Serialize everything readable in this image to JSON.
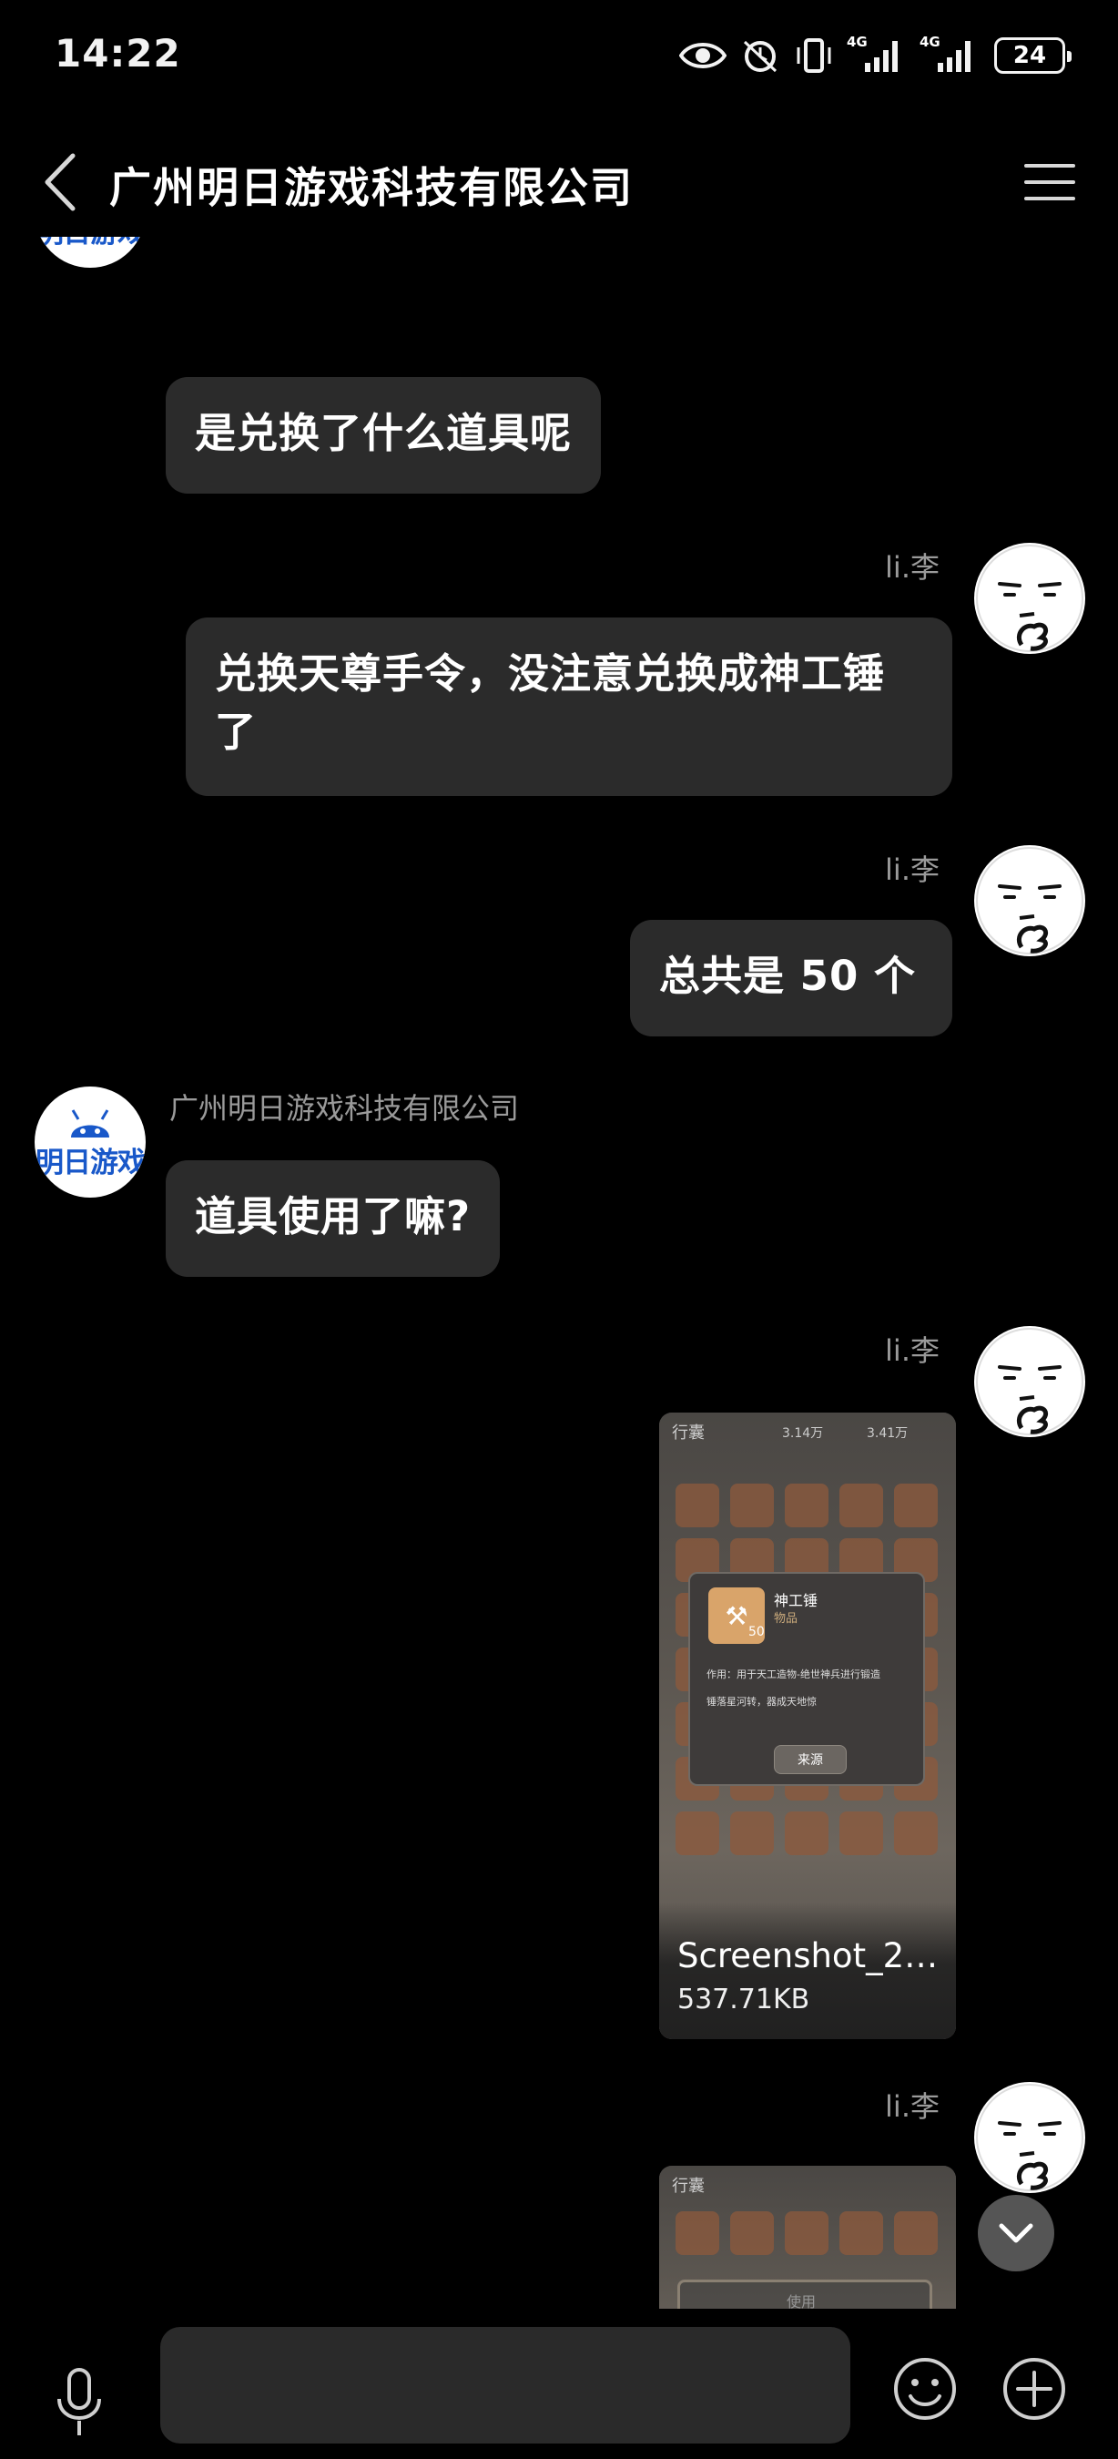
{
  "status_bar": {
    "time": "14:22",
    "battery": "24",
    "network_1": "4G",
    "network_2": "4G",
    "icons": [
      "eye-icon",
      "alarm-icon",
      "vibrate-icon",
      "signal-icon",
      "signal-icon",
      "battery-icon"
    ]
  },
  "header": {
    "title": "广州明日游戏科技有限公司",
    "back_icon": "chevron-left-icon",
    "menu_icon": "menu-icon"
  },
  "company": {
    "logo_text": "明日游戏",
    "name": "广州明日游戏科技有限公司"
  },
  "messages": [
    {
      "sender": "company",
      "text": "是兑换了什么道具呢"
    },
    {
      "sender": "user",
      "name": "li.李",
      "text": "兑换天尊手令，没注意兑换成神工锤了"
    },
    {
      "sender": "user",
      "name": "li.李",
      "text": "总共是 50 个"
    },
    {
      "sender": "company",
      "name": "广州明日游戏科技有限公司",
      "text": "道具使用了嘛?"
    },
    {
      "sender": "user",
      "name": "li.李",
      "type": "image",
      "file_name": "Screenshot_2…",
      "file_size": "537.71KB",
      "preview": {
        "top_label": "行囊",
        "stat_1": "3.14万",
        "stat_2": "3.41万",
        "item_name": "神工锤",
        "item_type": "物品",
        "item_count": "50",
        "description": "作用：用于天工造物-绝世神兵进行锻造",
        "description_2": "锤落星河转，器成天地惊",
        "source_button": "来源"
      }
    },
    {
      "sender": "user",
      "name": "li.李",
      "type": "image",
      "preview": {
        "top_label": "行囊",
        "popup_label": "使用"
      }
    }
  ],
  "input": {
    "placeholder": ""
  },
  "colors": {
    "background": "#000000",
    "bubble": "#2b2b2b",
    "name": "#9a9a9a",
    "logo_blue": "#1958c9"
  }
}
